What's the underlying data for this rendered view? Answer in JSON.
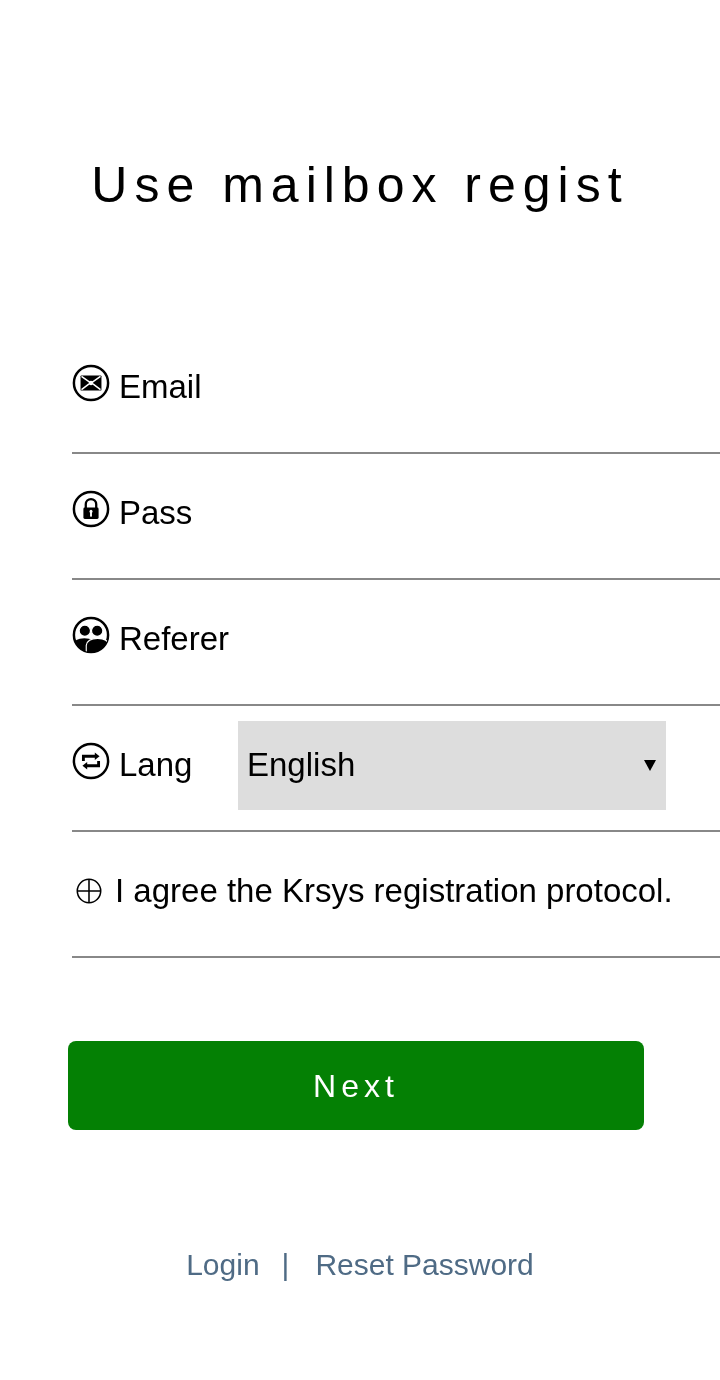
{
  "title": "Use mailbox regist",
  "fields": [
    {
      "kind": "email",
      "label": "Email"
    },
    {
      "kind": "password",
      "label": "Pass"
    },
    {
      "kind": "referer",
      "label": "Referer"
    }
  ],
  "language": {
    "label": "Lang",
    "value": "English"
  },
  "agreement": {
    "text": "I agree the Krsys registration protocol."
  },
  "next_button": {
    "label": "Next"
  },
  "links": [
    {
      "label": "Login"
    },
    {
      "label": "Reset Password"
    }
  ],
  "link_separator": "|"
}
